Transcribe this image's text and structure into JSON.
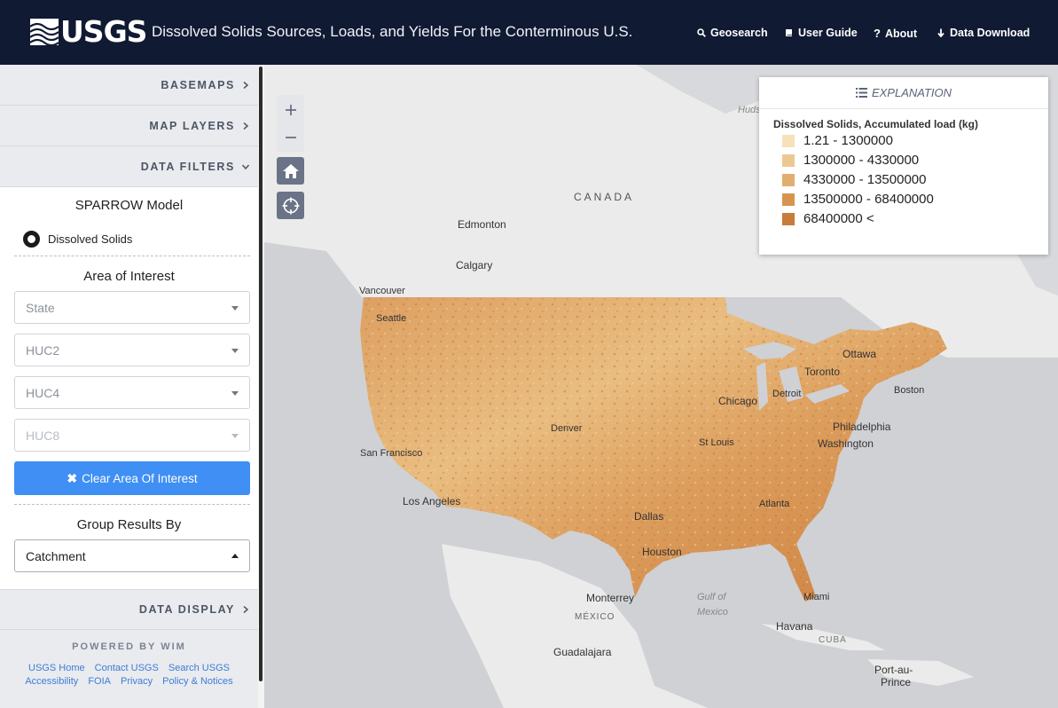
{
  "header": {
    "logo_text": "USGS",
    "title": "Dissolved Solids Sources, Loads, and Yields For the Conterminous U.S.",
    "nav": {
      "geosearch": "Geosearch",
      "user_guide": "User Guide",
      "about": "About",
      "data_download": "Data Download"
    }
  },
  "sidebar": {
    "basemaps": "BASEMAPS",
    "map_layers": "MAP LAYERS",
    "data_filters": "DATA FILTERS",
    "model_title": "SPARROW Model",
    "model_option": "Dissolved Solids",
    "aoi_title": "Area of Interest",
    "state_placeholder": "State",
    "huc2_placeholder": "HUC2",
    "huc4_placeholder": "HUC4",
    "huc8_placeholder": "HUC8",
    "clear_button": "Clear Area Of Interest",
    "group_title": "Group Results By",
    "group_value": "Catchment",
    "data_display": "DATA DISPLAY",
    "powered_by": "POWERED BY WIM",
    "footer_links": {
      "usgs_home": "USGS Home",
      "contact": "Contact USGS",
      "search": "Search USGS",
      "accessibility": "Accessibility",
      "foia": "FOIA",
      "privacy": "Privacy",
      "policy": "Policy & Notices"
    }
  },
  "legend": {
    "header": "EXPLANATION",
    "subtitle": "Dissolved Solids, Accumulated load (kg)",
    "items": [
      {
        "label": "1.21 - 1300000",
        "color": "#f7e1b8"
      },
      {
        "label": "1300000 - 4330000",
        "color": "#ecc891"
      },
      {
        "label": "4330000 - 13500000",
        "color": "#e2ae70"
      },
      {
        "label": "13500000 - 68400000",
        "color": "#d7944f"
      },
      {
        "label": "68400000 <",
        "color": "#c97b3a"
      }
    ]
  },
  "map": {
    "labels": {
      "canada": "CANADA",
      "edmonton": "Edmonton",
      "calgary": "Calgary",
      "vancouver": "Vancouver",
      "seattle": "Seattle",
      "ottawa": "Ottawa",
      "toronto": "Toronto",
      "detroit": "Detroit",
      "boston": "Boston",
      "chicago": "Chicago",
      "philadelphia": "Philadelphia",
      "washington": "Washington",
      "denver": "Denver",
      "st_louis": "St Louis",
      "san_francisco": "San Francisco",
      "los_angeles": "Los Angeles",
      "dallas": "Dallas",
      "atlanta": "Atlanta",
      "houston": "Houston",
      "monterrey": "Monterrey",
      "mexico": "MÉXICO",
      "gulf_1": "Gulf of",
      "gulf_2": "Mexico",
      "miami": "Miami",
      "havana": "Havana",
      "cuba": "CUBA",
      "guadalajara": "Guadalajara",
      "port_au_prince_1": "Port-au-",
      "port_au_prince_2": "Prince",
      "hudson": "Hudson"
    }
  },
  "colors": {
    "navbar": "#111a33",
    "accent_button": "#3f8ff4",
    "map_background": "#cfd1d5",
    "land": "#e8e8e8"
  }
}
